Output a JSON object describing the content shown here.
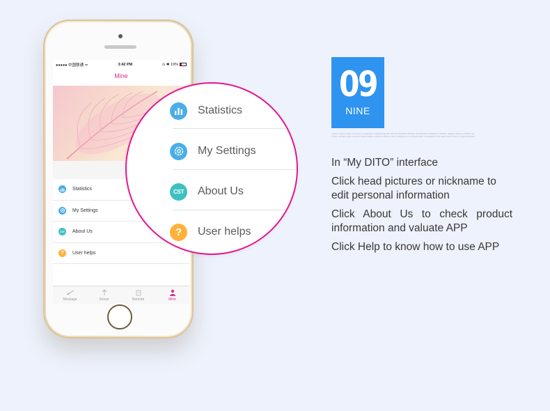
{
  "colors": {
    "accent_pink": "#e4168f",
    "badge_blue": "#2f93f0",
    "stats_icon": "#4aaee8",
    "settings_icon": "#4aaee8",
    "about_icon": "#3fc0c0",
    "help_icon": "#ffb23a"
  },
  "phone": {
    "status": {
      "carrier": "●●●●● 中国联通 ᯤ",
      "time": "3:42 PM",
      "battery": "⊙ ✱ 19%"
    },
    "title": "Mine",
    "menu": [
      {
        "label": "Statistics",
        "icon": "bar-chart-icon"
      },
      {
        "label": "My Settings",
        "icon": "gear-icon"
      },
      {
        "label": "About Us",
        "icon": "cst-logo-icon"
      },
      {
        "label": "User helps",
        "icon": "question-icon"
      }
    ],
    "tabs": [
      {
        "label": "Message",
        "icon": "message-icon"
      },
      {
        "label": "Sense",
        "icon": "sense-icon"
      },
      {
        "label": "Remote",
        "icon": "remote-icon"
      },
      {
        "label": "Mine",
        "icon": "person-icon",
        "active": true
      }
    ]
  },
  "magnifier": {
    "items": [
      {
        "label": "Statistics",
        "icon": "bar-chart-icon"
      },
      {
        "label": "My Settings",
        "icon": "gear-icon"
      },
      {
        "label": "About Us",
        "icon": "cst-logo-icon",
        "icon_text": "CST"
      },
      {
        "label": "User helps",
        "icon": "question-icon",
        "icon_text": "?"
      }
    ]
  },
  "badge": {
    "number": "09",
    "word": "NINE"
  },
  "fine_print": "Lorem ipsum dolor sit amet consectetur adipiscing elit sed do eiusmod tempor incididunt ut labore et dolore magna aliqua ut enim ad minim veniam quis nostrud exercitation ullamco laboris nisi ut aliquip ex ea commodo consequat duis aute irure dolor in reprehenderit",
  "info": [
    "In “My DITO” interface",
    "Click head pictures or nickname to edit personal information",
    "Click About Us to check product information and valuate APP",
    "Click Help to know how to use APP"
  ]
}
